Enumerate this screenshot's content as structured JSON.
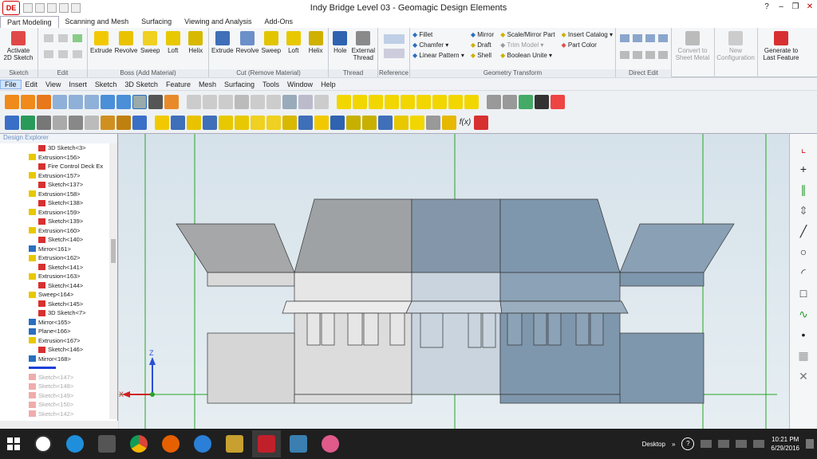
{
  "window": {
    "title": "Indy Bridge Level 03 - Geomagic Design Elements",
    "logo": "DE"
  },
  "ribbon_tabs": [
    "Part Modeling",
    "Scanning and Mesh",
    "Surfacing",
    "Viewing and Analysis",
    "Add-Ons"
  ],
  "ribbon": {
    "sketch": {
      "label": "Sketch",
      "button": "Activate 2D Sketch"
    },
    "edit": {
      "label": "Edit"
    },
    "boss": {
      "label": "Boss (Add Material)",
      "buttons": [
        "Extrude",
        "Revolve",
        "Sweep",
        "Loft",
        "Helix"
      ]
    },
    "cut": {
      "label": "Cut (Remove Material)",
      "buttons": [
        "Extrude",
        "Revolve",
        "Sweep",
        "Loft",
        "Helix"
      ]
    },
    "thread": {
      "label": "Thread",
      "buttons": [
        "Hole",
        "External Thread"
      ]
    },
    "reference": {
      "label": "Reference"
    },
    "geometry": {
      "label": "Geometry Transform",
      "col1": [
        "Fillet",
        "Chamfer",
        "Linear Pattern"
      ],
      "col2": [
        "Mirror",
        "Draft",
        "Shell"
      ],
      "col3": [
        "Scale/Mirror Part",
        "Trim Model",
        "Boolean Unite"
      ],
      "col4": [
        "Insert Catalog",
        "Part Color"
      ]
    },
    "direct": {
      "label": "Direct Edit"
    },
    "convert": {
      "buttons": [
        "Convert to Sheet Metal",
        "New Configuration",
        "Generate to Last Feature"
      ]
    }
  },
  "menu": [
    "File",
    "Edit",
    "View",
    "Insert",
    "Sketch",
    "3D Sketch",
    "Feature",
    "Mesh",
    "Surfacing",
    "Tools",
    "Window",
    "Help"
  ],
  "explorer": {
    "title": "Design Explorer",
    "items": [
      {
        "label": "3D Sketch<3>",
        "indent": 1,
        "icon": "sketch"
      },
      {
        "label": "Extrusion<156>",
        "indent": 0,
        "icon": "extrude"
      },
      {
        "label": "Fire Control Deck Ex",
        "indent": 1,
        "icon": "sketch"
      },
      {
        "label": "Extrusion<157>",
        "indent": 0,
        "icon": "extrude"
      },
      {
        "label": "Sketch<137>",
        "indent": 1,
        "icon": "sketch"
      },
      {
        "label": "Extrusion<158>",
        "indent": 0,
        "icon": "extrude"
      },
      {
        "label": "Sketch<138>",
        "indent": 1,
        "icon": "sketch"
      },
      {
        "label": "Extrusion<159>",
        "indent": 0,
        "icon": "extrude"
      },
      {
        "label": "Sketch<139>",
        "indent": 1,
        "icon": "sketch"
      },
      {
        "label": "Extrusion<160>",
        "indent": 0,
        "icon": "extrude"
      },
      {
        "label": "Sketch<140>",
        "indent": 1,
        "icon": "sketch"
      },
      {
        "label": "Mirror<161>",
        "indent": 0,
        "icon": "mirror"
      },
      {
        "label": "Extrusion<162>",
        "indent": 0,
        "icon": "extrude"
      },
      {
        "label": "Sketch<141>",
        "indent": 1,
        "icon": "sketch"
      },
      {
        "label": "Extrusion<163>",
        "indent": 0,
        "icon": "extrude"
      },
      {
        "label": "Sketch<144>",
        "indent": 1,
        "icon": "sketch"
      },
      {
        "label": "Sweep<164>",
        "indent": 0,
        "icon": "sweep"
      },
      {
        "label": "Sketch<145>",
        "indent": 1,
        "icon": "sketch"
      },
      {
        "label": "3D Sketch<7>",
        "indent": 1,
        "icon": "sketch"
      },
      {
        "label": "Mirror<165>",
        "indent": 0,
        "icon": "mirror"
      },
      {
        "label": "Plane<166>",
        "indent": 0,
        "icon": "plane"
      },
      {
        "label": "Extrusion<167>",
        "indent": 0,
        "icon": "extrude"
      },
      {
        "label": "Sketch<146>",
        "indent": 1,
        "icon": "sketch"
      },
      {
        "label": "Mirror<168>",
        "indent": 0,
        "icon": "mirror"
      },
      {
        "label": "",
        "indent": 0,
        "icon": "rollback"
      },
      {
        "label": "Sketch<147>",
        "indent": 0,
        "icon": "sketch",
        "gray": true
      },
      {
        "label": "Sketch<148>",
        "indent": 0,
        "icon": "sketch",
        "gray": true
      },
      {
        "label": "Sketch<149>",
        "indent": 0,
        "icon": "sketch",
        "gray": true
      },
      {
        "label": "Sketch<150>",
        "indent": 0,
        "icon": "sketch",
        "gray": true
      },
      {
        "label": "Sketch<142>",
        "indent": 0,
        "icon": "sketch",
        "gray": true
      }
    ]
  },
  "axes": {
    "x": "X",
    "z": "Z"
  },
  "right_tools": [
    "sketch-icon",
    "point-icon",
    "parallel-icon",
    "dimension-icon",
    "line-icon",
    "circle-icon",
    "arc-icon",
    "rectangle-icon",
    "spline-icon",
    "point-small-icon",
    "grid-icon",
    "trim-icon"
  ],
  "taskbar": {
    "desktop": "Desktop",
    "time": "10:21 PM",
    "date": "6/29/2016"
  },
  "colors": {
    "accent": "#2a6fbf",
    "model_left": "#d9d9d9",
    "model_mid": "#c9d4de",
    "model_right": "#7f97ad",
    "grid": "#28a428"
  }
}
